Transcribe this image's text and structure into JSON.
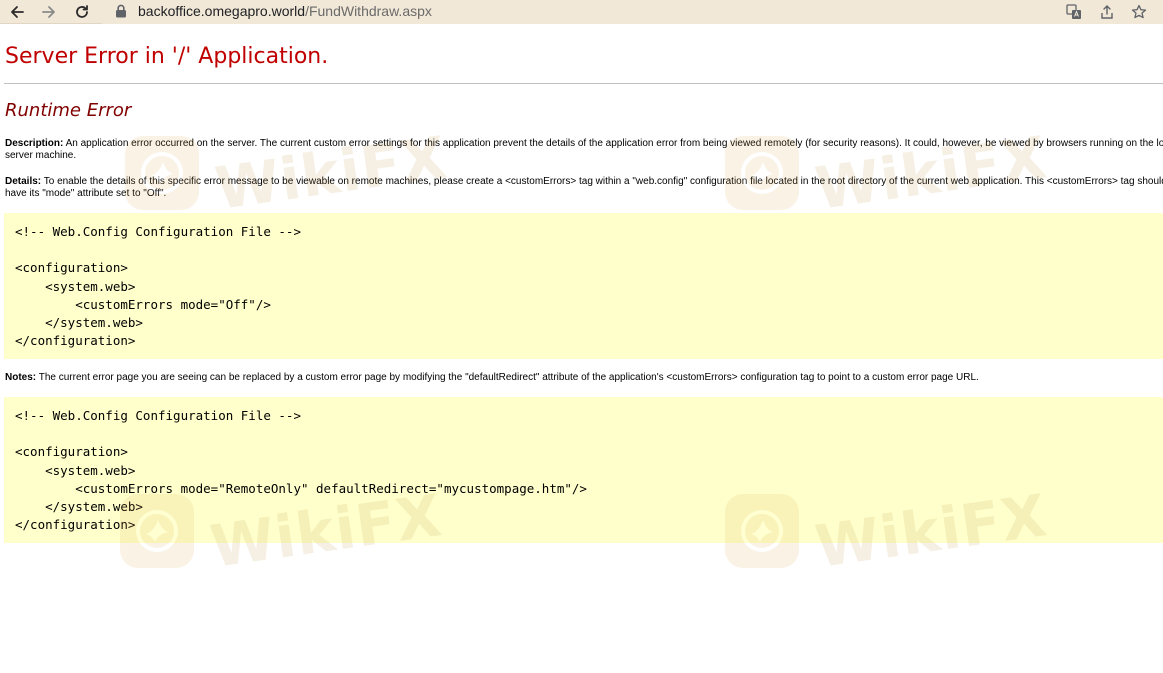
{
  "browser": {
    "url_host": "backoffice.omegapro.world",
    "url_path": "/FundWithdraw.aspx",
    "icons": [
      "back-arrow-icon",
      "forward-arrow-icon",
      "reload-icon",
      "lock-icon",
      "translate-icon",
      "share-icon",
      "bookmark-star-icon"
    ]
  },
  "error_page": {
    "title": "Server Error in '/' Application.",
    "subtitle": "Runtime Error",
    "description_label": "Description:",
    "description_text": " An application error occurred on the server. The current custom error settings for this application prevent the details of the application error from being viewed remotely (for security reasons). It could, however, be viewed by browsers running on the local server machine.",
    "details_label": "Details:",
    "details_text": " To enable the details of this specific error message to be viewable on remote machines, please create a <customErrors> tag within a \"web.config\" configuration file located in the root directory of the current web application. This <customErrors> tag should then have its \"mode\" attribute set to \"Off\".",
    "code_block_1": "<!-- Web.Config Configuration File -->\n\n<configuration>\n    <system.web>\n        <customErrors mode=\"Off\"/>\n    </system.web>\n</configuration>",
    "notes_label": "Notes:",
    "notes_text": " The current error page you are seeing can be replaced by a custom error page by modifying the \"defaultRedirect\" attribute of the application's <customErrors> configuration tag to point to a custom error page URL.",
    "code_block_2": "<!-- Web.Config Configuration File -->\n\n<configuration>\n    <system.web>\n        <customErrors mode=\"RemoteOnly\" defaultRedirect=\"mycustompage.htm\"/>\n    </system.web>\n</configuration>"
  },
  "watermark": {
    "text": "WikiFX",
    "color": "#d9a441"
  }
}
